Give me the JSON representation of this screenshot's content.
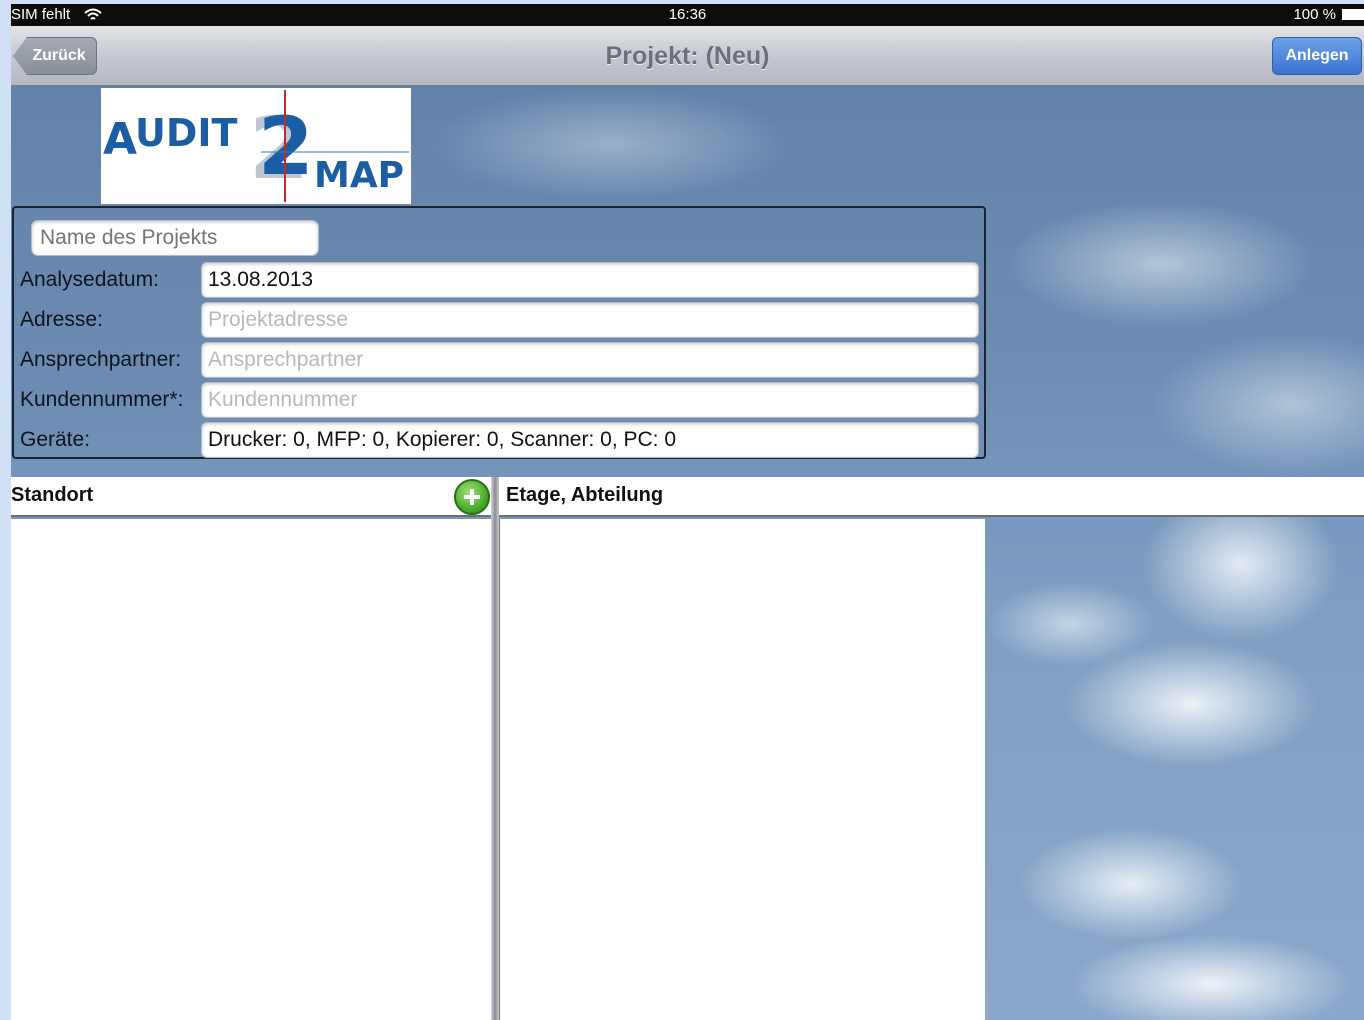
{
  "status_bar": {
    "carrier": "SIM fehlt",
    "time": "16:36",
    "battery": "100 %"
  },
  "nav": {
    "back_label": "Zurück",
    "title": "Projekt: (Neu)",
    "create_label": "Anlegen"
  },
  "logo": {
    "alt": "AUDIT 2 MAP"
  },
  "form": {
    "project_name_placeholder": "Name des Projekts",
    "rows": [
      {
        "label": "Analysedatum:",
        "value": "13.08.2013",
        "placeholder": ""
      },
      {
        "label": "Adresse:",
        "value": "",
        "placeholder": "Projektadresse"
      },
      {
        "label": "Ansprechpartner:",
        "value": "",
        "placeholder": "Ansprechpartner"
      },
      {
        "label": "Kundennummer*:",
        "value": "",
        "placeholder": "Kundennummer"
      },
      {
        "label": "Geräte:",
        "value": "Drucker: 0, MFP: 0, Kopierer: 0, Scanner: 0, PC: 0",
        "placeholder": ""
      }
    ]
  },
  "lists": {
    "standort_header": "Standort",
    "etage_header": "Etage, Abteilung",
    "add_icon": "plus-circle-icon"
  },
  "colors": {
    "primary_button": "#3b73d1",
    "add_button": "#3fa520",
    "nav_title": "#6c727c"
  }
}
